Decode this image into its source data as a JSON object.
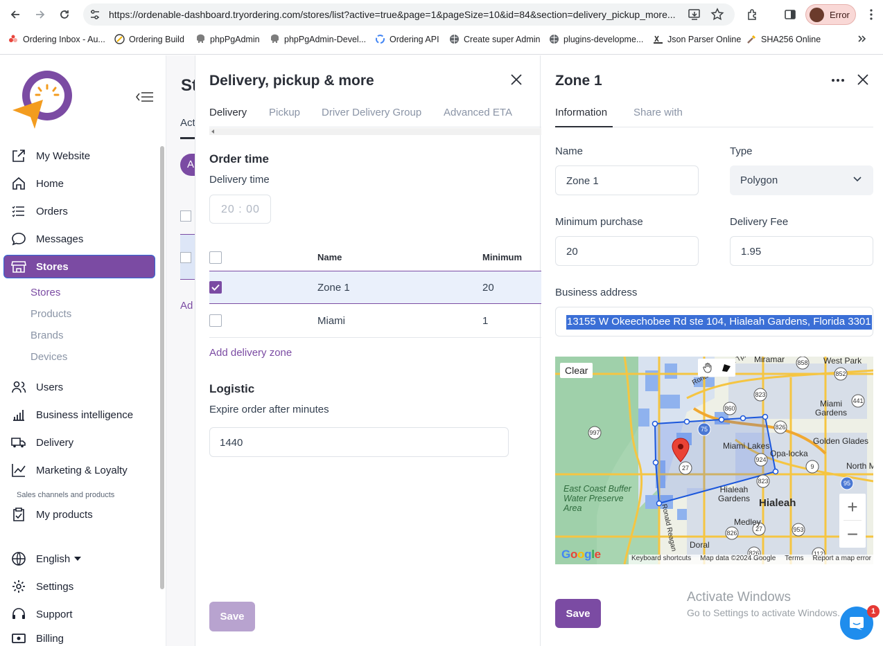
{
  "browser": {
    "url": "https://ordenable-dashboard.tryordering.com/stores/list?active=true&page=1&pageSize=10&id=84&section=delivery_pickup_more...",
    "profile_label": "Error",
    "bookmarks": [
      {
        "label": "Ordering Inbox - Au...",
        "icon": "ordering-icon"
      },
      {
        "label": "Ordering Build",
        "icon": "build-icon"
      },
      {
        "label": "phpPgAdmin",
        "icon": "elephant-icon"
      },
      {
        "label": "phpPgAdmin-Devel...",
        "icon": "elephant-icon"
      },
      {
        "label": "Ordering API",
        "icon": "api-icon"
      },
      {
        "label": "Create super Admin",
        "icon": "globe-icon"
      },
      {
        "label": "plugins-developme...",
        "icon": "globe-icon"
      },
      {
        "label": "Json Parser Online",
        "icon": "json-icon"
      },
      {
        "label": "SHA256 Online",
        "icon": "hash-icon"
      }
    ]
  },
  "sidebar": {
    "items": [
      {
        "label": "My Website",
        "icon": "external-link-icon"
      },
      {
        "label": "Home",
        "icon": "home-icon"
      },
      {
        "label": "Orders",
        "icon": "list-icon"
      },
      {
        "label": "Messages",
        "icon": "chat-icon"
      },
      {
        "label": "Stores",
        "icon": "store-icon"
      }
    ],
    "sub_items": [
      "Stores",
      "Products",
      "Brands",
      "Devices"
    ],
    "items2": [
      {
        "label": "Users",
        "icon": "users-icon"
      },
      {
        "label": "Business intelligence",
        "icon": "bar-chart-icon"
      },
      {
        "label": "Delivery",
        "icon": "truck-icon"
      },
      {
        "label": "Marketing & Loyalty",
        "icon": "trend-icon"
      }
    ],
    "section_label": "Sales channels and products",
    "my_products": "My products",
    "language": "English",
    "settings": "Settings",
    "support": "Support",
    "billing": "Billing"
  },
  "background_page": {
    "title_fragment": "St",
    "tab_fragment": "Act",
    "add_fragment": "Ad",
    "pill_fragment": "A"
  },
  "middle_panel": {
    "title": "Delivery, pickup & more",
    "tabs": [
      "Delivery",
      "Pickup",
      "Driver Delivery Group",
      "Advanced ETA"
    ],
    "order_time_heading": "Order time",
    "delivery_time_label": "Delivery time",
    "delivery_time_value": "20 : 00",
    "table": {
      "headers": [
        "Name",
        "Minimum"
      ],
      "rows": [
        {
          "name": "Zone 1",
          "minimum": "20",
          "checked": true
        },
        {
          "name": "Miami",
          "minimum": "1",
          "checked": false
        }
      ]
    },
    "add_zone_label": "Add delivery zone",
    "logistic_heading": "Logistic",
    "expire_label": "Expire order after minutes",
    "expire_value": "1440",
    "save_label": "Save"
  },
  "right_panel": {
    "title": "Zone 1",
    "tabs": [
      "Information",
      "Share with"
    ],
    "name_label": "Name",
    "name_value": "Zone 1",
    "type_label": "Type",
    "type_value": "Polygon",
    "min_purchase_label": "Minimum purchase",
    "min_purchase_value": "20",
    "delivery_fee_label": "Delivery Fee",
    "delivery_fee_value": "1.95",
    "business_address_label": "Business address",
    "business_address_value": "13155 W Okeechobee Rd ste 104, Hialeah Gardens, Florida 3301",
    "save_label": "Save"
  },
  "map": {
    "clear_label": "Clear",
    "places": [
      "Miramar",
      "West Park",
      "Miami Gardens",
      "Golden Glades",
      "Opa-locka",
      "North M",
      "Miami Lakes",
      "Hialeah Gardens",
      "Hialeah",
      "Medley",
      "Doral",
      "East Coast Buffer Water Preserve Area",
      "Ronald Reagan Tpke",
      "Ronald Reagan"
    ],
    "shields": [
      "858",
      "852",
      "860",
      "823",
      "441",
      "826",
      "997",
      "75",
      "924",
      "9",
      "27",
      "823",
      "95",
      "826",
      "27",
      "953",
      "826",
      "112"
    ],
    "footer": [
      "Keyboard shortcuts",
      "Map data ©2024 Google",
      "Terms",
      "Report a map error"
    ],
    "attribution": "Google",
    "zoom_in": "+",
    "zoom_out": "−",
    "polygon_color": "#1a56db",
    "marker_color": "#ea4335"
  },
  "overlay": {
    "activate_title": "Activate Windows",
    "activate_subtitle": "Go to Settings to activate Windows.",
    "chat_badge": "1"
  },
  "colors": {
    "accent": "#7b4ba3",
    "accent_disabled": "#b8a3cf",
    "selection_blue": "#3b6fd6"
  }
}
